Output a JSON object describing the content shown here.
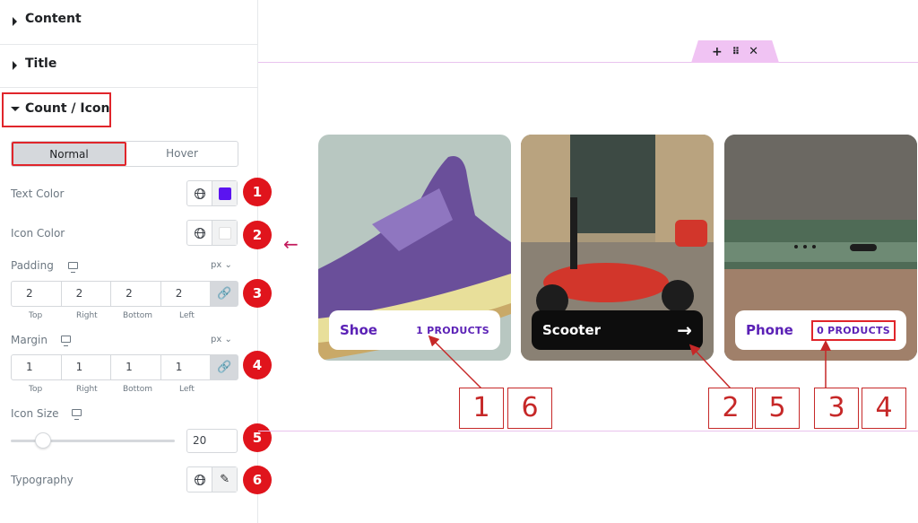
{
  "sections": {
    "content": "Content",
    "title": "Title",
    "count_icon": "Count / Icon"
  },
  "tabs": {
    "normal": "Normal",
    "hover": "Hover"
  },
  "controls": {
    "text_color": {
      "label": "Text Color",
      "value": "#5b14f0"
    },
    "icon_color": {
      "label": "Icon Color",
      "value": "#ffffff"
    },
    "padding": {
      "label": "Padding",
      "unit": "px",
      "values": [
        "2",
        "2",
        "2",
        "2"
      ],
      "sides": [
        "Top",
        "Right",
        "Bottom",
        "Left"
      ]
    },
    "margin": {
      "label": "Margin",
      "unit": "px",
      "values": [
        "1",
        "1",
        "1",
        "1"
      ],
      "sides": [
        "Top",
        "Right",
        "Bottom",
        "Left"
      ]
    },
    "icon_size": {
      "label": "Icon Size",
      "value": "20"
    },
    "typography": {
      "label": "Typography"
    }
  },
  "markers": [
    "1",
    "2",
    "3",
    "4",
    "5",
    "6"
  ],
  "cards": [
    {
      "name": "Shoe",
      "count": "1 PRODUCTS"
    },
    {
      "name": "Scooter"
    },
    {
      "name": "Phone",
      "count": "0 PRODUCTS"
    }
  ],
  "annotations": [
    "1",
    "6",
    "2",
    "5",
    "3",
    "4"
  ],
  "icons": {
    "toolbar": [
      "plus-icon",
      "drag-grip-icon",
      "close-icon"
    ],
    "responsive": "monitor-icon",
    "link": "link-icon",
    "edit": "pencil-icon",
    "global": "globe-icon"
  },
  "colors": {
    "accent_purple": "#5b21b6",
    "annotation_red": "#e0141c",
    "canvas_handle": "#f0c3f3"
  }
}
